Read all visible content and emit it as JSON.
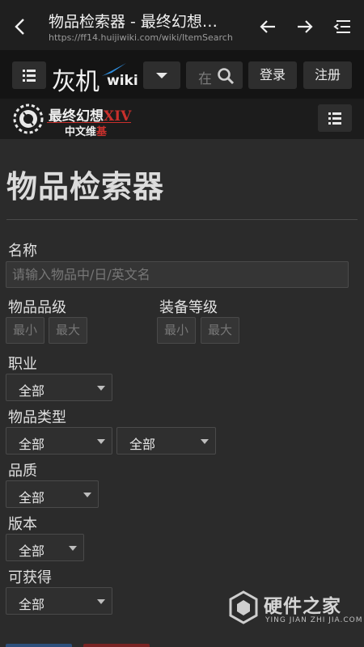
{
  "browser": {
    "title": "物品检索器 - 最终幻想…",
    "url": "https://ff14.huijiwiki.com/wiki/ItemSearch"
  },
  "header": {
    "logo_text": "灰机",
    "logo_wiki": "wiki",
    "search_placeholder": "在",
    "login": "登录",
    "register": "注册"
  },
  "subheader": {
    "logo_title": "最终幻想",
    "logo_title_suffix": "XIV",
    "logo_subtitle": "中文维",
    "logo_subtitle_suffix": "基"
  },
  "page": {
    "title": "物品检索器"
  },
  "form": {
    "name_label": "名称",
    "name_placeholder": "请输入物品中/日/英文名",
    "item_level_label": "物品品级",
    "equip_level_label": "装备等级",
    "min_placeholder": "最小",
    "max_placeholder": "最大",
    "job_label": "职业",
    "job_value": "全部",
    "type_label": "物品类型",
    "type_value_1": "全部",
    "type_value_2": "全部",
    "quality_label": "品质",
    "quality_value": "全部",
    "version_label": "版本",
    "version_value": "全部",
    "obtainable_label": "可获得",
    "obtainable_value": "全部"
  },
  "watermark": {
    "main": "硬件之家",
    "sub": "YING JIAN ZHI JIA.COM"
  },
  "colors": {
    "background": "#2b2b2b",
    "header": "#141414",
    "accent_red": "#c9302c",
    "logo_blue": "#2f8fe0"
  }
}
